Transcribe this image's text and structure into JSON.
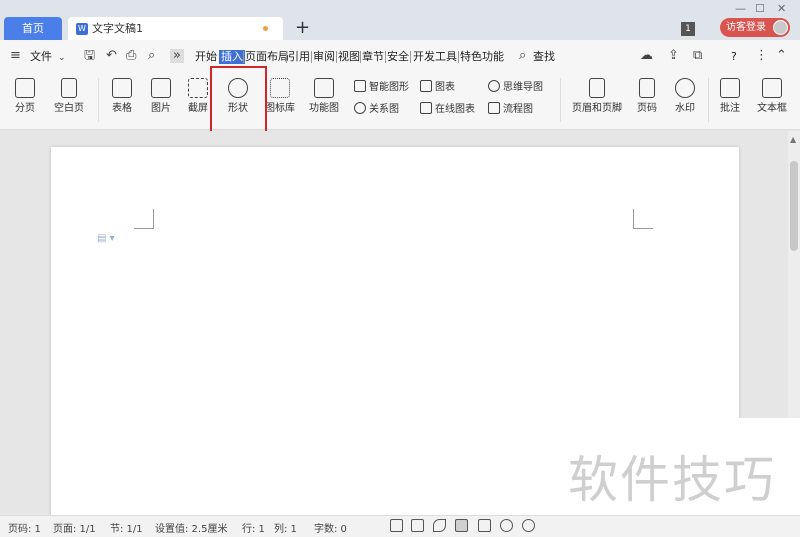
{
  "titlebar": {
    "home_tab": "首页",
    "doc_tab": "文字文稿1",
    "new_tab": "+",
    "window_count": "1",
    "visitor_login": "访客登录"
  },
  "menubar": {
    "file": "文件",
    "tabs": [
      "开始",
      "插入",
      "页面布局",
      "引用",
      "审阅",
      "视图",
      "章节",
      "安全",
      "开发工具",
      "特色功能"
    ],
    "active_tab": "插入",
    "search": "查找",
    "help": "?"
  },
  "ribbon": {
    "page_break": "分页",
    "blank_page": "空白页",
    "table": "表格",
    "picture": "图片",
    "screenshot": "截屏",
    "shape": "形状",
    "icon_library": "图标库",
    "function_chart": "功能图",
    "smart_shape": "智能图形",
    "relation_chart": "关系图",
    "chart": "图表",
    "online_chart": "在线图表",
    "mind_map": "思维导图",
    "flow_chart": "流程图",
    "header_footer": "页眉和页脚",
    "page_number": "页码",
    "watermark": "水印",
    "comment": "批注",
    "textbox": "文本框"
  },
  "statusbar": {
    "page_no": "页码: 1",
    "pages": "页面: 1/1",
    "section": "节: 1/1",
    "setting": "设置值: 2.5厘米",
    "row": "行: 1",
    "col": "列: 1",
    "words": "字数: 0"
  },
  "watermark_text": "软件技巧"
}
